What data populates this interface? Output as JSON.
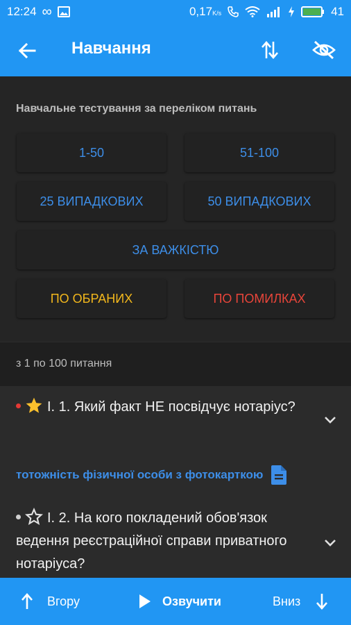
{
  "status": {
    "time": "12:24",
    "speed": "0,17",
    "speed_unit": "K/s",
    "battery": "41",
    "icons": [
      "infinity-icon",
      "image-icon",
      "phone-icon",
      "wifi-icon",
      "signal-icon",
      "charging-icon",
      "battery-icon"
    ]
  },
  "appbar": {
    "title": "Навчання",
    "icons": [
      "back-arrow-icon",
      "sort-icon",
      "eye-off-icon"
    ]
  },
  "training": {
    "heading": "Навчальне тестування за переліком питань",
    "buttons": {
      "range1": "1-50",
      "range2": "51-100",
      "random25": "25 ВИПАДКОВИХ",
      "random50": "50 ВИПАДКОВИХ",
      "difficulty": "ЗА ВАЖКІСТЮ",
      "favorites": "ПО ОБРАНИХ",
      "mistakes": "ПО ПОМИЛКАХ"
    }
  },
  "range_label": "з 1 по 100 питання",
  "questions": [
    {
      "text": "І. 1. Який факт НЕ посвідчує нотаріус?",
      "answer": "тотожність фізичної особи з фотокарткою",
      "starred": true,
      "dot_color": "#e53935"
    },
    {
      "text": "І. 2. На кого покладений обов'язок ведення реєстраційної справи приватного нотаріуса?",
      "starred": false,
      "dot_color": "#d0d0d0"
    }
  ],
  "bottom": {
    "up": "Вгору",
    "speak": "Озвучити",
    "down": "Вниз"
  },
  "colors": {
    "primary": "#2196f3",
    "link": "#3d8ee8",
    "favorite": "#f2b71c",
    "mistake": "#e8453a",
    "star": "#fbc02d"
  }
}
